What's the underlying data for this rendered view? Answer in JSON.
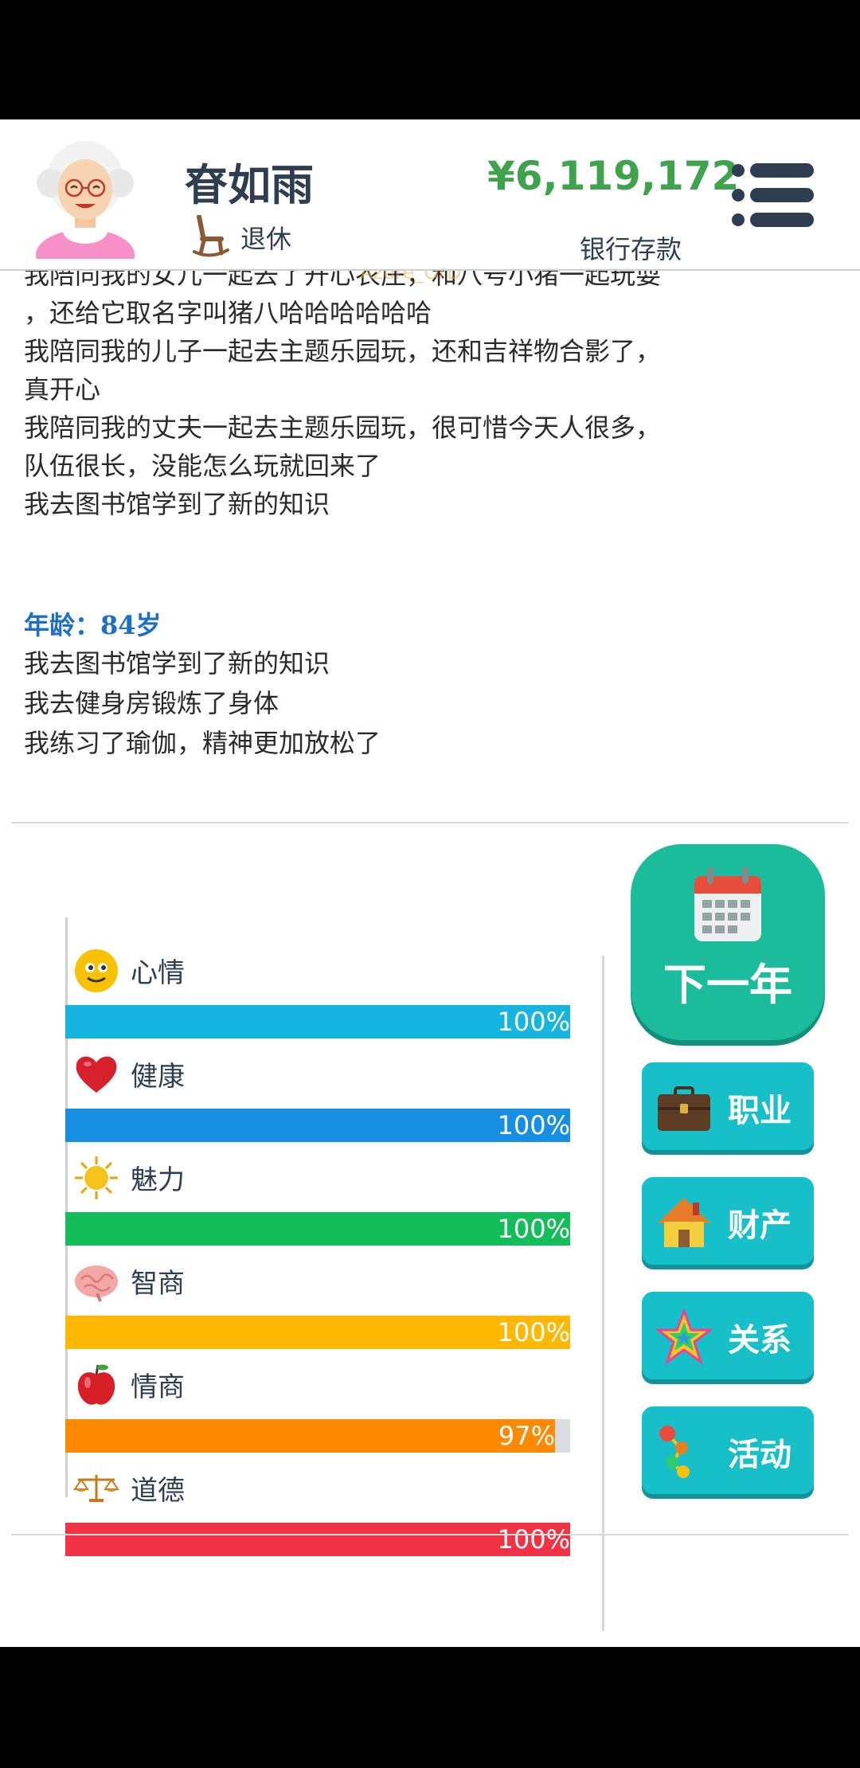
{
  "header": {
    "name": "眘如雨",
    "status": "退休",
    "money": "¥6,119,172",
    "money_label": "银行存款",
    "watermark": "Azure_OrD"
  },
  "log": {
    "lines": [
      "我陪同我的女儿一起去了开心农庄，和八号小猪一起玩耍",
      "，还给它取名字叫猪八哈哈哈哈哈哈",
      "我陪同我的儿子一起去主题乐园玩，还和吉祥物合影了，",
      "真开心",
      "我陪同我的丈夫一起去主题乐园玩，很可惜今天人很多，",
      "队伍很长，没能怎么玩就回来了",
      "我去图书馆学到了新的知识"
    ],
    "age_heading": "年龄：84岁",
    "age_lines": [
      "我去图书馆学到了新的知识",
      "我去健身房锻炼了身体",
      "我练习了瑜伽，精神更加放松了"
    ]
  },
  "stats": [
    {
      "label": "心情",
      "value": 100,
      "display": "100%",
      "color": "#16b4e1",
      "icon": "smiley-face-icon"
    },
    {
      "label": "健康",
      "value": 100,
      "display": "100%",
      "color": "#168fe3",
      "icon": "heart-icon"
    },
    {
      "label": "魅力",
      "value": 100,
      "display": "100%",
      "color": "#13be5a",
      "icon": "sun-icon"
    },
    {
      "label": "智商",
      "value": 100,
      "display": "100%",
      "color": "#ffb700",
      "icon": "brain-icon"
    },
    {
      "label": "情商",
      "value": 97,
      "display": "97%",
      "color": "#ff8a00",
      "icon": "apple-icon"
    },
    {
      "label": "道德",
      "value": 100,
      "display": "100%",
      "color": "#f23345",
      "icon": "scales-icon"
    }
  ],
  "buttons": {
    "next_year": "下一年",
    "career": "职业",
    "assets": "财产",
    "relations": "关系",
    "activities": "活动"
  },
  "colors": {
    "money": "#3fa34d",
    "age_heading": "#1d6fc4",
    "next_year_button": "#1abc9c",
    "side_button": "#17c0c9"
  }
}
